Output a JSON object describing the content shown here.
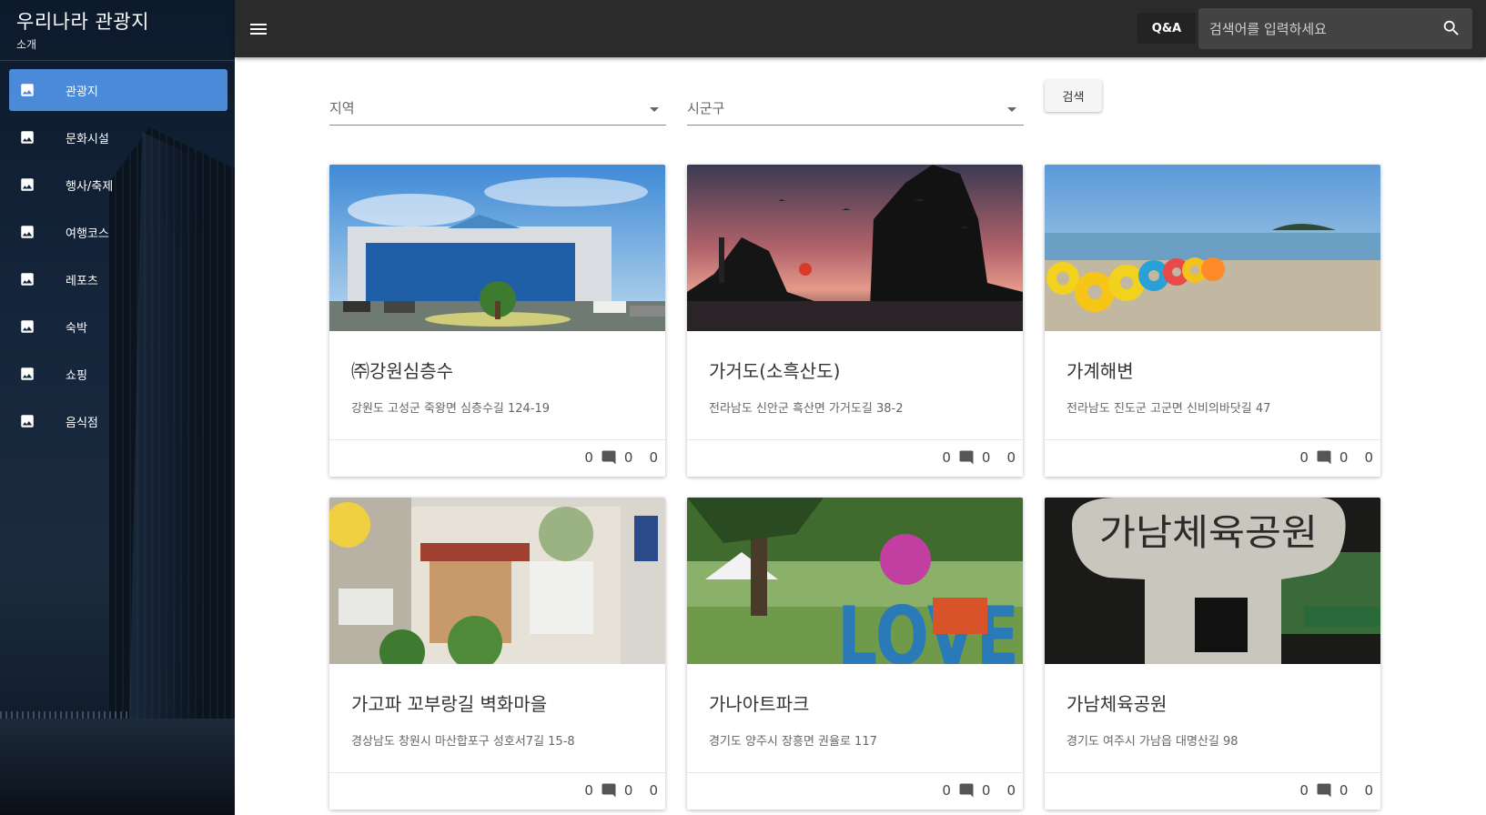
{
  "brand": {
    "title": "우리나라 관광지",
    "subtitle": "소개"
  },
  "sidebar": {
    "items": [
      {
        "label": "관광지",
        "icon": "image-icon",
        "active": true
      },
      {
        "label": "문화시설",
        "icon": "image-icon"
      },
      {
        "label": "행사/축제",
        "icon": "image-icon"
      },
      {
        "label": "여행코스",
        "icon": "image-icon"
      },
      {
        "label": "레포츠",
        "icon": "image-icon"
      },
      {
        "label": "숙박",
        "icon": "image-icon"
      },
      {
        "label": "쇼핑",
        "icon": "image-icon"
      },
      {
        "label": "음식점",
        "icon": "image-icon"
      }
    ]
  },
  "header": {
    "qa_label": "Q&A",
    "search_placeholder": "검색어를 입력하세요",
    "menu_icon": "menu-icon",
    "search_icon": "search-icon"
  },
  "filters": {
    "region_label": "지역",
    "district_label": "시군구",
    "search_button": "검색"
  },
  "cards": [
    {
      "title": "㈜강원심층수",
      "address": "강원도 고성군 죽왕면 심층수길 124-19",
      "count1": "0",
      "comments": "0",
      "count3": "0"
    },
    {
      "title": "가거도(소흑산도)",
      "address": "전라남도 신안군 흑산면 가거도길 38-2",
      "count1": "0",
      "comments": "0",
      "count3": "0"
    },
    {
      "title": "가계해변",
      "address": "전라남도 진도군 고군면 신비의바닷길 47",
      "count1": "0",
      "comments": "0",
      "count3": "0"
    },
    {
      "title": "가고파 꼬부랑길 벽화마을",
      "address": "경상남도 창원시 마산합포구 성호서7길 15-8",
      "count1": "0",
      "comments": "0",
      "count3": "0"
    },
    {
      "title": "가나아트파크",
      "address": "경기도 양주시 장흥면 권율로 117",
      "count1": "0",
      "comments": "0",
      "count3": "0"
    },
    {
      "title": "가남체육공원",
      "address": "경기도 여주시 가남읍 대명산길 98",
      "count1": "0",
      "comments": "0",
      "count3": "0"
    }
  ],
  "photo_text": {
    "sign": "가남체육공원",
    "love": "LOVE"
  },
  "colors": {
    "accent": "#4a8ad8",
    "topbar": "#2b2b2b",
    "search_bg": "#434343"
  }
}
